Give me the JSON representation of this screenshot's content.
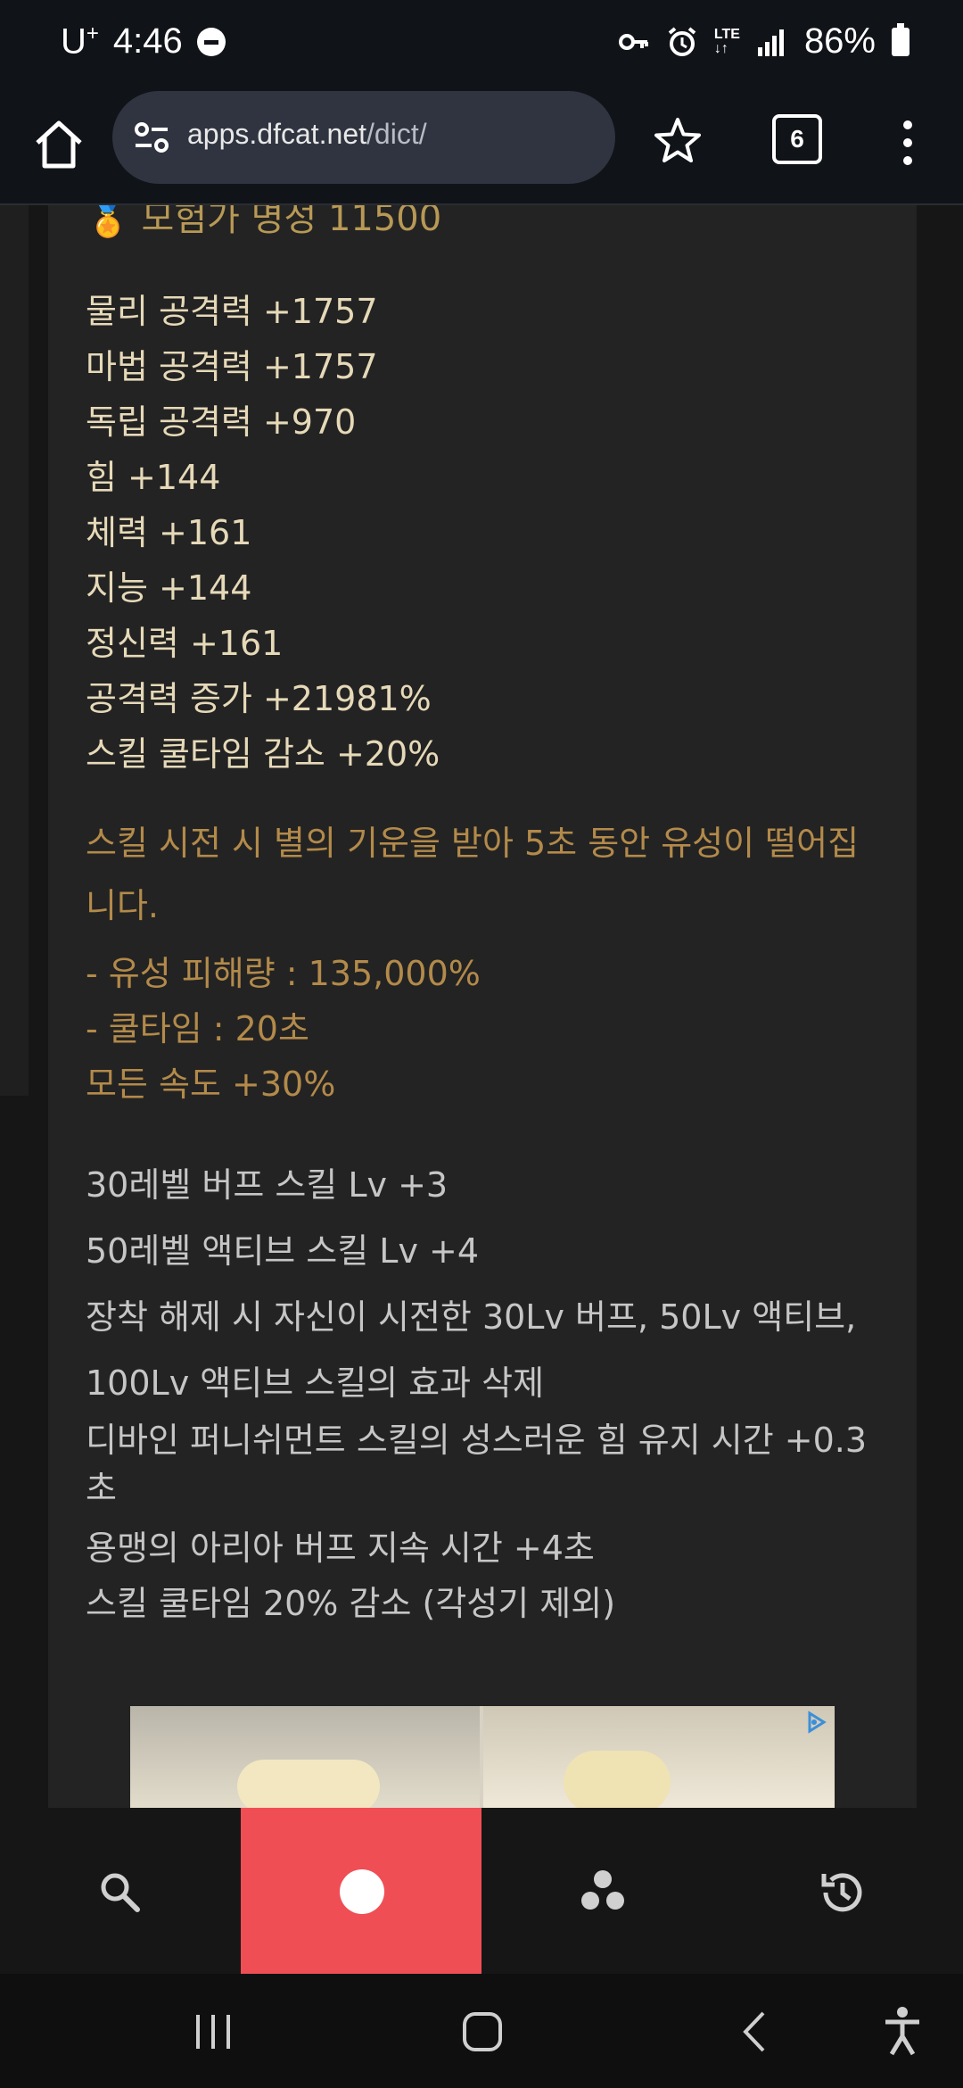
{
  "status_bar": {
    "carrier": "U",
    "carrier_sup": "+",
    "time": "4:46",
    "network": "LTE",
    "battery": "86%"
  },
  "browser": {
    "url_domain": "apps.dfcat.net",
    "url_path": "/dict/",
    "tab_count": "6"
  },
  "content": {
    "clipped_line": "모험가 명성 11500",
    "stats": [
      "물리 공격력 +1757",
      "마법 공격력 +1757",
      "독립 공격력 +970",
      "힘 +144",
      "체력 +161",
      "지능 +144",
      "정신력 +161",
      "공격력 증가 +21981%",
      "스킬 쿨타임 감소 +20%"
    ],
    "option": {
      "description": "스킬 시전 시 별의 기운을 받아 5초 동안 유성이 떨어집니다.",
      "damage": "- 유성 피해량 : 135,000%",
      "cooldown": "- 쿨타임 : 20초",
      "speed": "모든 속도 +30%"
    },
    "extra": [
      "30레벨 버프 스킬 Lv +3",
      "50레벨 액티브 스킬 Lv +4",
      "장착 해제 시 자신이 시전한 30Lv 버프, 50Lv 액티브,",
      "100Lv 액티브 스킬의 효과 삭제",
      "디바인 퍼니쉬먼트 스킬의 성스러운 힘 유지 시간 +0.3",
      "초",
      "용맹의 아리아 버프 지속 시간 +4초",
      "스킬 쿨타임 20% 감소 (각성기 제외)"
    ]
  },
  "colors": {
    "stat_text": "#e6d9b8",
    "option_text": "#b38a4a",
    "grey_text": "#c6c6c6",
    "accent_active_tab": "#f04e55",
    "card_bg": "#232323",
    "page_bg": "#161616"
  },
  "icons": {
    "home": "home-icon",
    "site_settings": "site-settings-icon",
    "bookmark": "star-icon",
    "menu": "more-vert-icon",
    "nav_search": "search-icon",
    "nav_record": "circle-icon",
    "nav_group": "dots-group-icon",
    "nav_history": "history-icon"
  }
}
